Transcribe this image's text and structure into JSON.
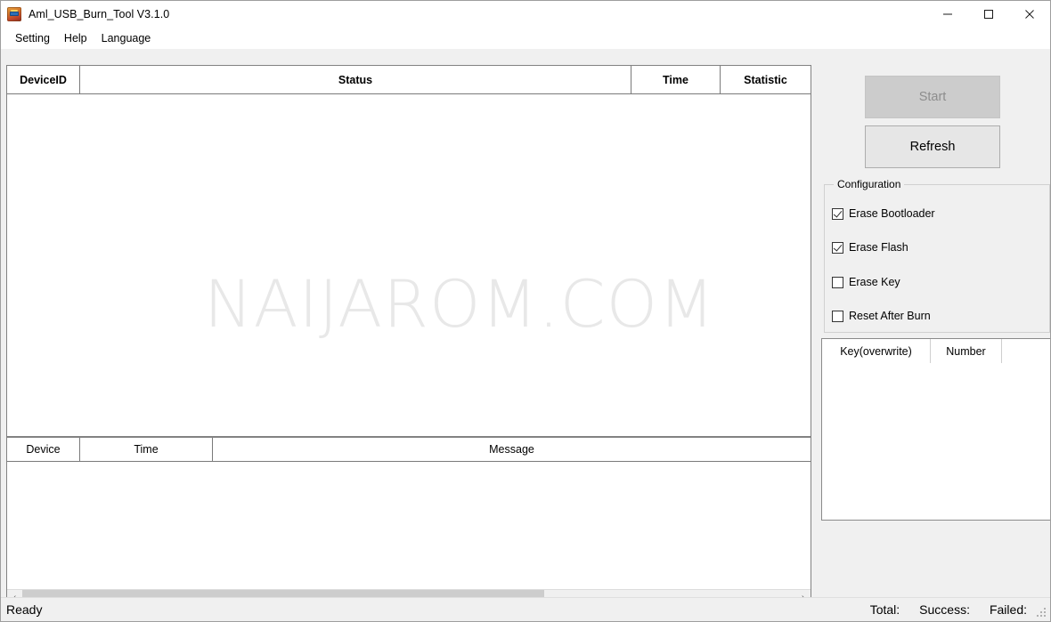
{
  "window": {
    "title": "Aml_USB_Burn_Tool V3.1.0",
    "app_icon": "amlogic-burn-tool-icon",
    "minimize_label": "—",
    "maximize_label": "□",
    "close_label": "✕"
  },
  "menubar": {
    "items": [
      {
        "label": "Setting"
      },
      {
        "label": "Help"
      },
      {
        "label": "Language"
      }
    ]
  },
  "watermark": {
    "text": "NAIJAROM.COM"
  },
  "device_list": {
    "columns": [
      "DeviceID",
      "Status",
      "Time",
      "Statistic"
    ],
    "rows": []
  },
  "log_list": {
    "columns": [
      "Device",
      "Time",
      "Message"
    ],
    "rows": [],
    "scrollbar": {
      "left_arrow": "‹",
      "right_arrow": "›",
      "thumb_percent": 67.5
    }
  },
  "actions": {
    "start_label": "Start",
    "start_enabled": false,
    "refresh_label": "Refresh",
    "refresh_enabled": true
  },
  "configuration": {
    "legend": "Configuration",
    "options": [
      {
        "label": "Erase Bootloader",
        "checked": true
      },
      {
        "label": "Erase Flash",
        "checked": true
      },
      {
        "label": "Erase Key",
        "checked": false
      },
      {
        "label": "Reset After Burn",
        "checked": false
      }
    ]
  },
  "key_list": {
    "columns": [
      "Key(overwrite)",
      "Number",
      ""
    ],
    "rows": []
  },
  "statusbar": {
    "ready": "Ready",
    "total_label": "Total:",
    "success_label": "Success:",
    "failed_label": "Failed:"
  },
  "colors": {
    "window_bg": "#f0f0f0",
    "grid_bg": "#ffffff",
    "button_face": "#e6e6e6",
    "button_disabled": "#cccccc",
    "watermark": "#e8e8e8",
    "scroll_thumb": "#cdcdcd"
  }
}
